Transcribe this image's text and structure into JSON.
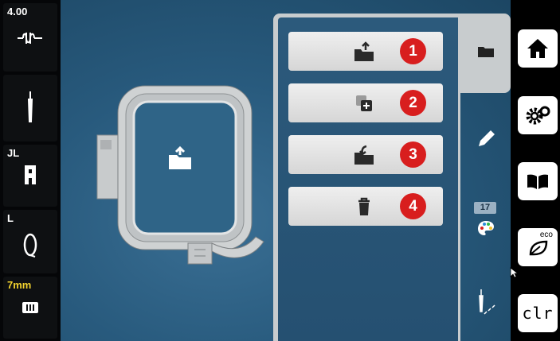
{
  "status_bar": {
    "tension_value": "4.00",
    "foot_label": "JL",
    "bobbin_label": "L",
    "stitch_length": "7mm"
  },
  "actions": [
    {
      "label": "1",
      "icon": "folder-open-icon"
    },
    {
      "label": "2",
      "icon": "duplicate-icon"
    },
    {
      "label": "3",
      "icon": "folder-save-icon"
    },
    {
      "label": "4",
      "icon": "trash-icon"
    }
  ],
  "tabs": {
    "active": "folder",
    "color_count": "17"
  },
  "right_nav": {
    "eco_label": "eco",
    "clear_label": "clr"
  },
  "colors": {
    "accent_red": "#d81e1e",
    "panel_gray": "#c8ccce",
    "background_blue": "#285a7d"
  }
}
